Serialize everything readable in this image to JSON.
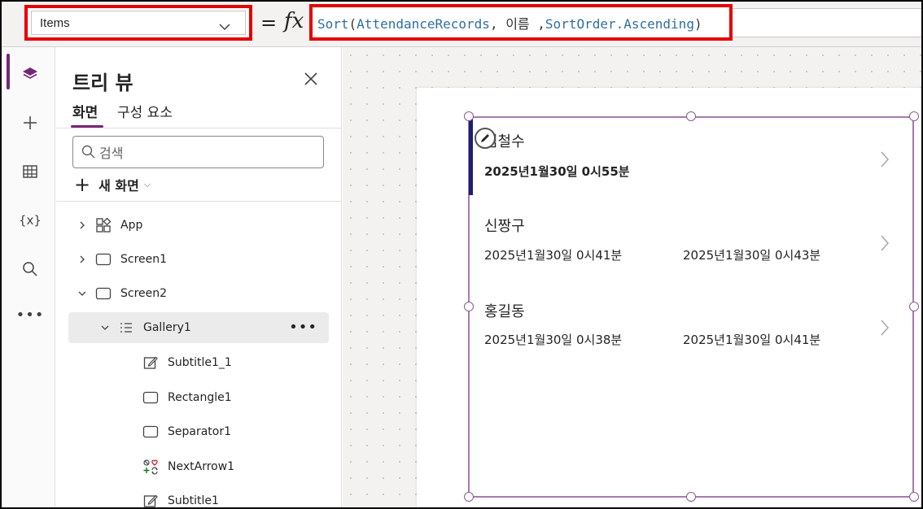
{
  "formula_bar": {
    "property": "Items",
    "equals": "=",
    "fx": "fx",
    "formula_tokens": {
      "fn": "Sort",
      "open": "(",
      "arg1": "AttendanceRecords",
      "sep1": ", ",
      "arg2": "이름",
      "sep2": " ,",
      "arg3": "SortOrder.Ascending",
      "close": ")"
    }
  },
  "panel": {
    "title": "트리 뷰",
    "tabs": [
      "화면",
      "구성 요소"
    ],
    "search_placeholder": "검색",
    "new_screen": "새 화면",
    "tree": [
      {
        "label": "App",
        "icon": "app-icon"
      },
      {
        "label": "Screen1",
        "icon": "screen-icon"
      },
      {
        "label": "Screen2",
        "icon": "screen-icon"
      },
      {
        "label": "Gallery1",
        "icon": "gallery-icon"
      },
      {
        "label": "Subtitle1_1",
        "icon": "edit-text-icon"
      },
      {
        "label": "Rectangle1",
        "icon": "rectangle-icon"
      },
      {
        "label": "Separator1",
        "icon": "rectangle-icon"
      },
      {
        "label": "NextArrow1",
        "icon": "icons-icon"
      },
      {
        "label": "Subtitle1",
        "icon": "edit-text-icon"
      }
    ]
  },
  "gallery": {
    "rows": [
      {
        "name": "김철수",
        "time1": "2025년1월30일 0시55분",
        "time2": ""
      },
      {
        "name": "신짱구",
        "time1": "2025년1월30일 0시41분",
        "time2": "2025년1월30일 0시43분"
      },
      {
        "name": "홍길동",
        "time1": "2025년1월30일 0시38분",
        "time2": "2025년1월30일 0시41분"
      }
    ]
  },
  "colors": {
    "accent": "#742774",
    "highlight_red": "#e50000",
    "selection_bar": "#1f1f6e",
    "gallery_border": "#a67aaf"
  }
}
